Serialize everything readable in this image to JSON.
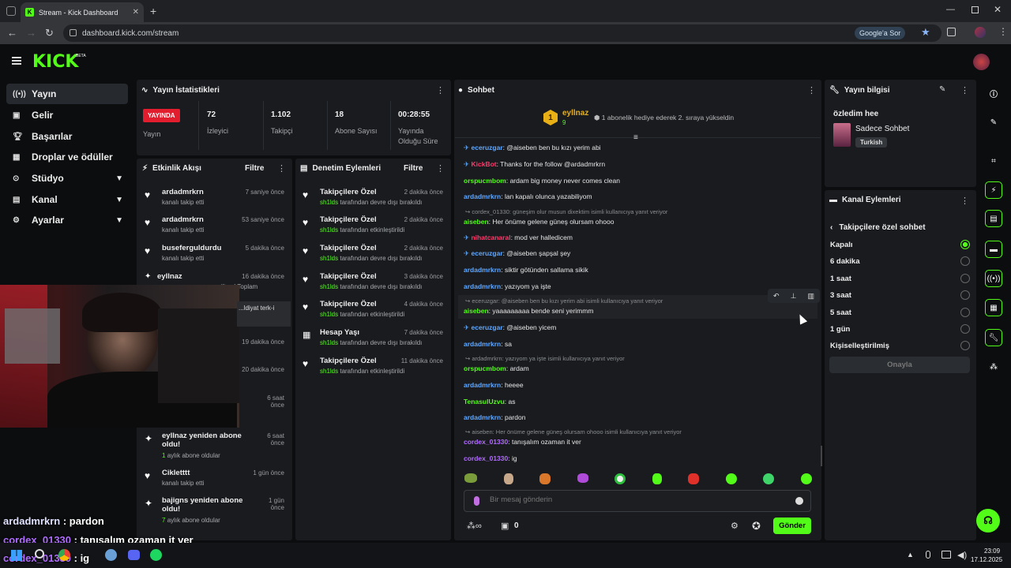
{
  "browser": {
    "tab_title": "Stream - Kick Dashboard",
    "url": "dashboard.kick.com/stream",
    "google_btn": "Google'a Sor"
  },
  "sidebar": {
    "items": [
      {
        "label": "Yayın",
        "icon": "broadcast-icon"
      },
      {
        "label": "Gelir",
        "icon": "wallet-icon"
      },
      {
        "label": "Başarılar",
        "icon": "trophy-icon"
      },
      {
        "label": "Droplar ve ödüller",
        "icon": "gift-icon"
      },
      {
        "label": "Stüdyo",
        "icon": "studio-icon"
      },
      {
        "label": "Kanal",
        "icon": "channel-icon"
      },
      {
        "label": "Ayarlar",
        "icon": "gear-icon"
      }
    ]
  },
  "stats": {
    "title": "Yayın İstatistikleri",
    "live_badge": "YAYINDA",
    "live_label": "Yayın",
    "viewers": "72",
    "viewers_label": "İzleyici",
    "followers": "1.102",
    "followers_label": "Takipçi",
    "subs": "18",
    "subs_label": "Abone Sayısı",
    "duration": "00:28:55",
    "duration_label1": "Yayında",
    "duration_label2": "Olduğu Süre"
  },
  "activity": {
    "title": "Etkinlik Akışı",
    "filter": "Filtre",
    "items": [
      {
        "name": "ardadmrkrn",
        "sub": "kanalı takip etti",
        "time": "7 saniye önce"
      },
      {
        "name": "ardadmrkrn",
        "sub": "kanalı takip etti",
        "time": "53 saniye önce"
      },
      {
        "name": "buseferguldurdu",
        "sub": "kanalı takip etti",
        "time": "5 dakika önce"
      },
      {
        "name": "eyllnaz",
        "sub": "...iliyor! Toplam",
        "time": "16 dakika önce"
      },
      {
        "name": "",
        "sub": "",
        "time": "19 dakika önce"
      },
      {
        "name": "",
        "sub": "",
        "time": "20 dakika önce"
      },
      {
        "name": "",
        "sub": "",
        "time": "6 saat önce"
      },
      {
        "name": "eyllnaz yeniden abone oldu!",
        "sub_num": "1",
        "sub": "aylık abone oldular",
        "time": "6 saat önce"
      },
      {
        "name": "Cikletttt",
        "sub": "kanalı takip etti",
        "time": "1 gün önce"
      },
      {
        "name": "bajigns yeniden abone oldu!",
        "sub_num": "7",
        "sub": "aylık abone oldular",
        "time": "1 gün önce"
      }
    ],
    "overlay_text": "...ldiyat terk-i"
  },
  "moderation": {
    "title": "Denetim Eylemleri",
    "filter": "Filtre",
    "items": [
      {
        "title": "Takipçilere Özel",
        "by": "sh1lds",
        "sub": " tarafından devre dışı bırakıldı",
        "time": "2 dakika önce"
      },
      {
        "title": "Takipçilere Özel",
        "by": "sh1lds",
        "sub": " tarafından etkinleştirildi",
        "time": "2 dakika önce"
      },
      {
        "title": "Takipçilere Özel",
        "by": "sh1lds",
        "sub": " tarafından devre dışı bırakıldı",
        "time": "2 dakika önce"
      },
      {
        "title": "Takipçilere Özel",
        "by": "sh1lds",
        "sub": " tarafından devre dışı bırakıldı",
        "time": "3 dakika önce"
      },
      {
        "title": "Takipçilere Özel",
        "by": "sh1lds",
        "sub": " tarafından etkinleştirildi",
        "time": "4 dakika önce"
      },
      {
        "title": "Hesap Yaşı",
        "by": "sh1lds",
        "sub": " tarafından devre dışı bırakıldı",
        "time": "7 dakika önce"
      },
      {
        "title": "Takipçilere Özel",
        "by": "sh1lds",
        "sub": " tarafından etkinleştirildi",
        "time": "11 dakika önce"
      }
    ]
  },
  "chat": {
    "title": "Sohbet",
    "pinned_user": "eyllnaz",
    "pinned_rank": "1",
    "pinned_count": "9",
    "pinned_msg": "1 abonelik hediye ederek 2. sıraya yükseldin",
    "lines": [
      {
        "type": "msg",
        "user": "eceruzgar",
        "ucls": "u-blue",
        "text": ": @aiseben ben bu kızı yerim abi",
        "badge": true
      },
      {
        "type": "msg",
        "user": "KickBot",
        "ucls": "u-red",
        "text": ": Thanks for the follow @ardadmrkrn",
        "badge": true
      },
      {
        "type": "msg",
        "user": "orspucmbom",
        "ucls": "u-green",
        "text": ": ardam big money never comes clean"
      },
      {
        "type": "msg",
        "user": "ardadmrkrn",
        "ucls": "u-blue",
        "text": ": lan kapalı olunca yazabiliyom"
      },
      {
        "type": "reply",
        "text": "cordex_01330: güneşim olur musun dixektim isimli kullanıcıya yanıt veriyor"
      },
      {
        "type": "msg",
        "user": "aiseben",
        "ucls": "u-green",
        "text": ": Her önüme gelene güneş olursam ohooo"
      },
      {
        "type": "msg",
        "user": "nihatcanaral",
        "ucls": "u-red",
        "text": ": mod ver halledicem",
        "badge": true
      },
      {
        "type": "msg",
        "user": "eceruzgar",
        "ucls": "u-blue",
        "text": ": @aiseben şapşal şey",
        "badge": true
      },
      {
        "type": "msg",
        "user": "ardadmrkrn",
        "ucls": "u-blue",
        "text": ": siktir götünden sallama sikik"
      },
      {
        "type": "msg",
        "user": "ardadmrkrn",
        "ucls": "u-blue",
        "text": ": yazıyom ya işte"
      },
      {
        "type": "reply",
        "text": "eceruzgar: @aiseben ben bu kızı yerim abi isimli kullanıcıya yanıt veriyor"
      },
      {
        "type": "msg",
        "user": "aiseben",
        "ucls": "u-green",
        "text": ": yaaaaaaaaa bende seni yerimmm"
      },
      {
        "type": "msg",
        "user": "eceruzgar",
        "ucls": "u-blue",
        "text": ": @aiseben yicem",
        "badge": true
      },
      {
        "type": "msg",
        "user": "ardadmrkrn",
        "ucls": "u-blue",
        "text": ": sa"
      },
      {
        "type": "reply",
        "text": "ardadmrkrn: yazıyom ya işte isimli kullanıcıya yanıt veriyor"
      },
      {
        "type": "msg",
        "user": "orspucmbom",
        "ucls": "u-green",
        "text": ": ardam"
      },
      {
        "type": "msg",
        "user": "ardadmrkrn",
        "ucls": "u-blue",
        "text": ": heeee"
      },
      {
        "type": "msg",
        "user": "TenasulUzvu",
        "ucls": "u-green",
        "text": ": as"
      },
      {
        "type": "msg",
        "user": "ardadmrkrn",
        "ucls": "u-blue",
        "text": ": pardon"
      },
      {
        "type": "reply",
        "text": "aiseben: Her önüme gelene güneş olursam ohooo isimli kullanıcıya yanıt veriyor"
      },
      {
        "type": "msg",
        "user": "cordex_01330",
        "ucls": "u-purple",
        "text": ": tanışalım ozaman it ver"
      },
      {
        "type": "msg",
        "user": "cordex_01330",
        "ucls": "u-purple",
        "text": ": ig"
      }
    ],
    "input_placeholder": "Bir mesaj gönderin",
    "points": "0",
    "send": "Gönder"
  },
  "stream_info": {
    "title": "Yayın bilgisi",
    "stream_title": "özledim hee",
    "category": "Sadece Sohbet",
    "lang": "Turkish"
  },
  "channel_actions": {
    "title": "Kanal Eylemleri",
    "sub_title": "Takipçilere özel sohbet",
    "options": [
      "Kapalı",
      "6 dakika",
      "1 saat",
      "3 saat",
      "5 saat",
      "1 gün",
      "Kişiselleştirilmiş"
    ],
    "selected": 0,
    "confirm": "Onayla"
  },
  "overlay": {
    "line1_user": "ardadmrkrn",
    "line1_text": " : pardon",
    "line2_user": "cordex_01330",
    "line2_text": " : tanışalım ozaman it ver",
    "line3_user": "cordex_01330",
    "line3_text": " : ig"
  },
  "taskbar": {
    "time": "23:09",
    "date": "17.12.2025"
  }
}
